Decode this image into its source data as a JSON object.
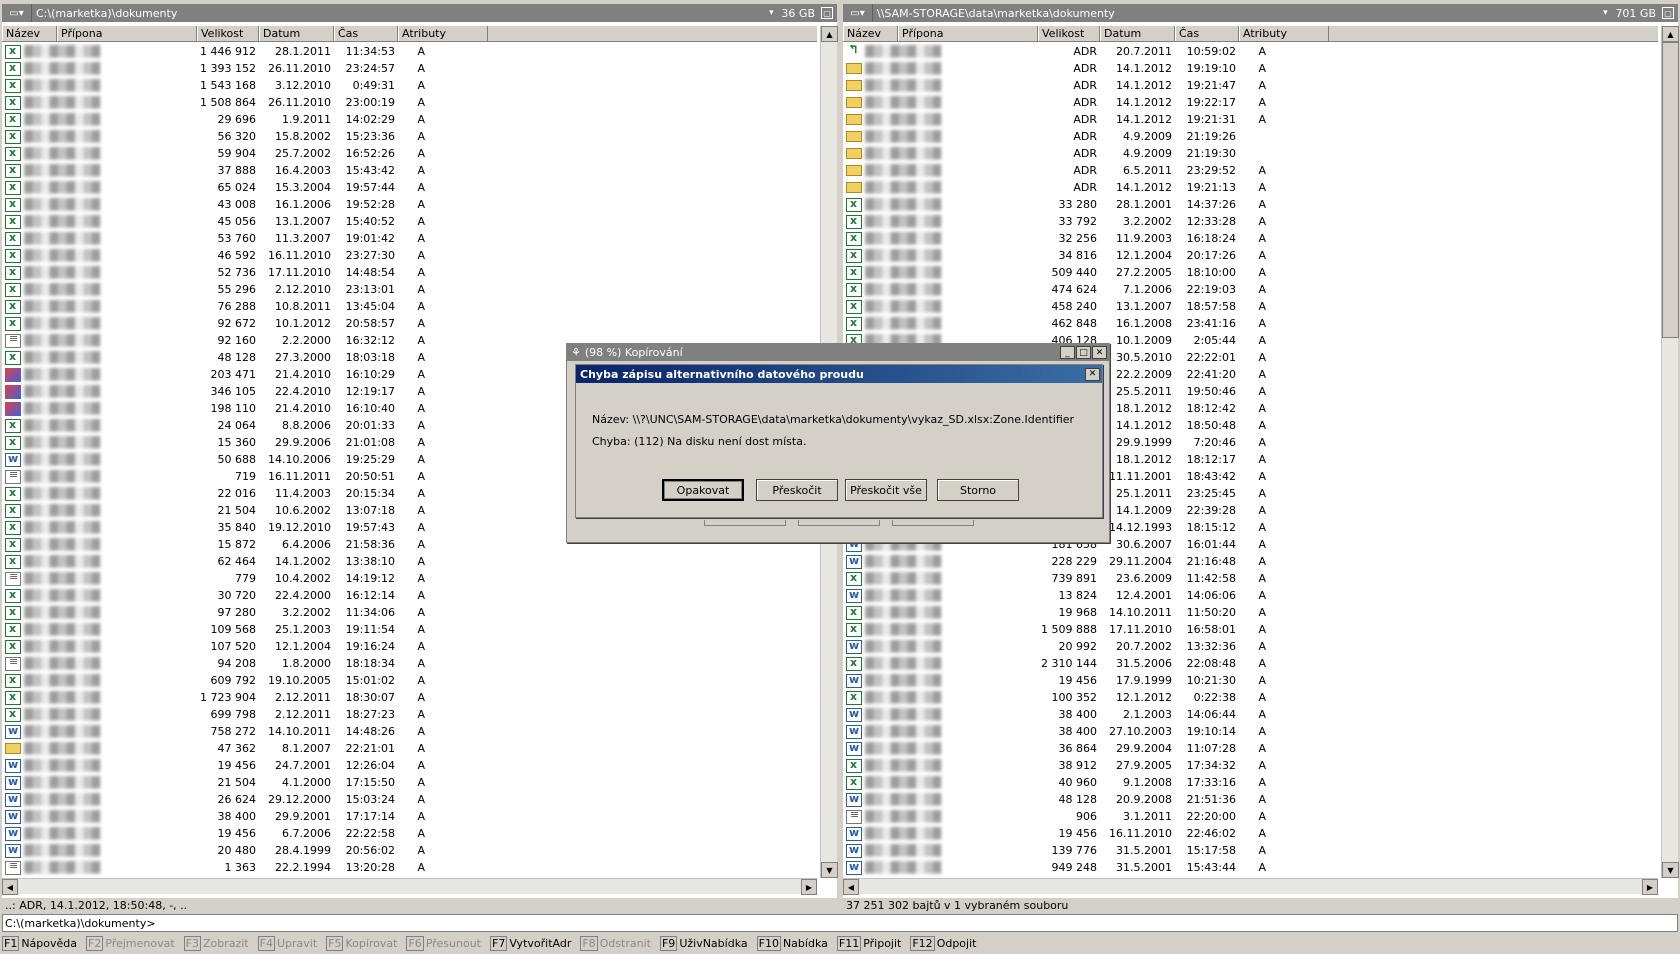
{
  "left": {
    "drive_label": "▾",
    "path": "C:\\(marketka)\\dokumenty",
    "free": "36 GB",
    "columns": [
      "Název",
      "Přípona",
      "Velikost",
      "Datum",
      "Čas",
      "Atributy"
    ],
    "status": "..: ADR, 14.1.2012, 18:50:48, -, ..",
    "rows": [
      {
        "icon": "xls",
        "size": "1 446 912",
        "date": "28.1.2011",
        "time": "11:34:53",
        "attr": "A"
      },
      {
        "icon": "xls",
        "size": "1 393 152",
        "date": "26.11.2010",
        "time": "23:24:57",
        "attr": "A"
      },
      {
        "icon": "xls",
        "size": "1 543 168",
        "date": "3.12.2010",
        "time": "0:49:31",
        "attr": "A"
      },
      {
        "icon": "xls",
        "size": "1 508 864",
        "date": "26.11.2010",
        "time": "23:00:19",
        "attr": "A"
      },
      {
        "icon": "xls",
        "size": "29 696",
        "date": "1.9.2011",
        "time": "14:02:29",
        "attr": "A"
      },
      {
        "icon": "xls",
        "size": "56 320",
        "date": "15.8.2002",
        "time": "15:23:36",
        "attr": "A"
      },
      {
        "icon": "xls",
        "size": "59 904",
        "date": "25.7.2002",
        "time": "16:52:26",
        "attr": "A"
      },
      {
        "icon": "xls",
        "size": "37 888",
        "date": "16.4.2003",
        "time": "15:43:42",
        "attr": "A"
      },
      {
        "icon": "xls",
        "size": "65 024",
        "date": "15.3.2004",
        "time": "19:57:44",
        "attr": "A"
      },
      {
        "icon": "xls",
        "size": "43 008",
        "date": "16.1.2006",
        "time": "19:52:28",
        "attr": "A"
      },
      {
        "icon": "xls",
        "size": "45 056",
        "date": "13.1.2007",
        "time": "15:40:52",
        "attr": "A"
      },
      {
        "icon": "xls",
        "size": "53 760",
        "date": "11.3.2007",
        "time": "19:01:42",
        "attr": "A"
      },
      {
        "icon": "xls",
        "size": "46 592",
        "date": "16.11.2010",
        "time": "23:27:30",
        "attr": "A"
      },
      {
        "icon": "xls",
        "size": "52 736",
        "date": "17.11.2010",
        "time": "14:48:54",
        "attr": "A"
      },
      {
        "icon": "xls",
        "size": "55 296",
        "date": "2.12.2010",
        "time": "23:13:01",
        "attr": "A"
      },
      {
        "icon": "xls",
        "size": "76 288",
        "date": "10.8.2011",
        "time": "13:45:04",
        "attr": "A"
      },
      {
        "icon": "xls",
        "size": "92 672",
        "date": "10.1.2012",
        "time": "20:58:57",
        "attr": "A"
      },
      {
        "icon": "txt",
        "size": "92 160",
        "date": "2.2.2000",
        "time": "16:32:12",
        "attr": "A"
      },
      {
        "icon": "xls",
        "size": "48 128",
        "date": "27.3.2000",
        "time": "18:03:18",
        "attr": "A"
      },
      {
        "icon": "img",
        "size": "203 471",
        "date": "21.4.2010",
        "time": "16:10:29",
        "attr": "A"
      },
      {
        "icon": "img",
        "size": "346 105",
        "date": "22.4.2010",
        "time": "12:19:17",
        "attr": "A"
      },
      {
        "icon": "img",
        "size": "198 110",
        "date": "21.4.2010",
        "time": "16:10:40",
        "attr": "A"
      },
      {
        "icon": "xls",
        "size": "24 064",
        "date": "8.8.2006",
        "time": "20:01:33",
        "attr": "A"
      },
      {
        "icon": "xls",
        "size": "15 360",
        "date": "29.9.2006",
        "time": "21:01:08",
        "attr": "A"
      },
      {
        "icon": "doc",
        "size": "50 688",
        "date": "14.10.2006",
        "time": "19:25:29",
        "attr": "A"
      },
      {
        "icon": "txt",
        "size": "719",
        "date": "16.11.2011",
        "time": "20:50:51",
        "attr": "A"
      },
      {
        "icon": "xls",
        "size": "22 016",
        "date": "11.4.2003",
        "time": "20:15:34",
        "attr": "A"
      },
      {
        "icon": "xls",
        "size": "21 504",
        "date": "10.6.2002",
        "time": "13:07:18",
        "attr": "A"
      },
      {
        "icon": "xls",
        "size": "35 840",
        "date": "19.12.2010",
        "time": "19:57:43",
        "attr": "A"
      },
      {
        "icon": "xls",
        "size": "15 872",
        "date": "6.4.2006",
        "time": "21:58:36",
        "attr": "A"
      },
      {
        "icon": "xls",
        "size": "62 464",
        "date": "14.1.2002",
        "time": "13:38:10",
        "attr": "A"
      },
      {
        "icon": "txt",
        "size": "779",
        "date": "10.4.2002",
        "time": "14:19:12",
        "attr": "A"
      },
      {
        "icon": "xls",
        "size": "30 720",
        "date": "22.4.2000",
        "time": "16:12:14",
        "attr": "A"
      },
      {
        "icon": "xls",
        "size": "97 280",
        "date": "3.2.2002",
        "time": "11:34:06",
        "attr": "A"
      },
      {
        "icon": "xls",
        "size": "109 568",
        "date": "25.1.2003",
        "time": "19:11:54",
        "attr": "A"
      },
      {
        "icon": "xls",
        "size": "107 520",
        "date": "12.1.2004",
        "time": "19:16:24",
        "attr": "A"
      },
      {
        "icon": "txt",
        "size": "94 208",
        "date": "1.8.2000",
        "time": "18:18:34",
        "attr": "A"
      },
      {
        "icon": "xls",
        "size": "609 792",
        "date": "19.10.2005",
        "time": "15:01:02",
        "attr": "A"
      },
      {
        "icon": "xls",
        "size": "1 723 904",
        "date": "2.12.2011",
        "time": "18:30:07",
        "attr": "A"
      },
      {
        "icon": "xls",
        "size": "699 798",
        "date": "2.12.2011",
        "time": "18:27:23",
        "attr": "A"
      },
      {
        "icon": "doc",
        "size": "758 272",
        "date": "14.10.2011",
        "time": "14:48:26",
        "attr": "A"
      },
      {
        "icon": "folder",
        "size": "47 362",
        "date": "8.1.2007",
        "time": "22:21:01",
        "attr": "A"
      },
      {
        "icon": "doc",
        "size": "19 456",
        "date": "24.7.2001",
        "time": "12:26:04",
        "attr": "A"
      },
      {
        "icon": "doc",
        "size": "21 504",
        "date": "4.1.2000",
        "time": "17:15:50",
        "attr": "A"
      },
      {
        "icon": "doc",
        "size": "26 624",
        "date": "29.12.2000",
        "time": "15:03:24",
        "attr": "A"
      },
      {
        "icon": "doc",
        "size": "38 400",
        "date": "29.9.2001",
        "time": "17:17:14",
        "attr": "A"
      },
      {
        "icon": "doc",
        "size": "19 456",
        "date": "6.7.2006",
        "time": "22:22:58",
        "attr": "A"
      },
      {
        "icon": "doc",
        "size": "20 480",
        "date": "28.4.1999",
        "time": "20:56:02",
        "attr": "A"
      },
      {
        "icon": "txt",
        "size": "1 363",
        "date": "22.2.1994",
        "time": "13:20:28",
        "attr": "A"
      }
    ]
  },
  "right": {
    "drive_label": "▾",
    "path": "\\\\SAM-STORAGE\\data\\marketka\\dokumenty",
    "free": "701 GB",
    "columns": [
      "Název",
      "Přípona",
      "Velikost",
      "Datum",
      "Čas",
      "Atributy"
    ],
    "status": "37 251 302 bajtů v 1 vybraném souboru",
    "rows": [
      {
        "icon": "up",
        "size": "ADR",
        "date": "20.7.2011",
        "time": "10:59:02",
        "attr": "A"
      },
      {
        "icon": "folder",
        "size": "ADR",
        "date": "14.1.2012",
        "time": "19:19:10",
        "attr": "A"
      },
      {
        "icon": "folder",
        "size": "ADR",
        "date": "14.1.2012",
        "time": "19:21:47",
        "attr": "A"
      },
      {
        "icon": "folder",
        "size": "ADR",
        "date": "14.1.2012",
        "time": "19:22:17",
        "attr": "A"
      },
      {
        "icon": "folder",
        "size": "ADR",
        "date": "14.1.2012",
        "time": "19:21:31",
        "attr": "A"
      },
      {
        "icon": "folder",
        "size": "ADR",
        "date": "4.9.2009",
        "time": "21:19:26",
        "attr": ""
      },
      {
        "icon": "folder",
        "size": "ADR",
        "date": "4.9.2009",
        "time": "21:19:30",
        "attr": ""
      },
      {
        "icon": "folder",
        "size": "ADR",
        "date": "6.5.2011",
        "time": "23:29:52",
        "attr": "A"
      },
      {
        "icon": "folder",
        "size": "ADR",
        "date": "14.1.2012",
        "time": "19:21:13",
        "attr": "A"
      },
      {
        "icon": "xls",
        "size": "33 280",
        "date": "28.1.2001",
        "time": "14:37:26",
        "attr": "A"
      },
      {
        "icon": "xls",
        "size": "33 792",
        "date": "3.2.2002",
        "time": "12:33:28",
        "attr": "A"
      },
      {
        "icon": "xls",
        "size": "32 256",
        "date": "11.9.2003",
        "time": "16:18:24",
        "attr": "A"
      },
      {
        "icon": "xls",
        "size": "34 816",
        "date": "12.1.2004",
        "time": "20:17:26",
        "attr": "A"
      },
      {
        "icon": "xls",
        "size": "509 440",
        "date": "27.2.2005",
        "time": "18:10:00",
        "attr": "A"
      },
      {
        "icon": "xls",
        "size": "474 624",
        "date": "7.1.2006",
        "time": "22:19:03",
        "attr": "A"
      },
      {
        "icon": "xls",
        "size": "458 240",
        "date": "13.1.2007",
        "time": "18:57:58",
        "attr": "A"
      },
      {
        "icon": "xls",
        "size": "462 848",
        "date": "16.1.2008",
        "time": "23:41:16",
        "attr": "A"
      },
      {
        "icon": "xls",
        "size": "406 128",
        "date": "10.1.2009",
        "time": "2:05:44",
        "attr": "A"
      },
      {
        "icon": "xls",
        "size": "",
        "date": "30.5.2010",
        "time": "22:22:01",
        "attr": "A"
      },
      {
        "icon": "xls",
        "size": "",
        "date": "22.2.2009",
        "time": "22:41:20",
        "attr": "A"
      },
      {
        "icon": "xls",
        "size": "",
        "date": "25.5.2011",
        "time": "19:50:46",
        "attr": "A"
      },
      {
        "icon": "xls",
        "size": "",
        "date": "18.1.2012",
        "time": "18:12:42",
        "attr": "A"
      },
      {
        "icon": "xls",
        "size": "",
        "date": "14.1.2012",
        "time": "18:50:48",
        "attr": "A"
      },
      {
        "icon": "xls",
        "size": "",
        "date": "29.9.1999",
        "time": "7:20:46",
        "attr": "A"
      },
      {
        "icon": "xls",
        "size": "",
        "date": "18.1.2012",
        "time": "18:12:17",
        "attr": "A"
      },
      {
        "icon": "xls",
        "size": "",
        "date": "11.11.2001",
        "time": "18:43:42",
        "attr": "A"
      },
      {
        "icon": "xls",
        "size": "",
        "date": "25.1.2011",
        "time": "23:25:45",
        "attr": "A"
      },
      {
        "icon": "xls",
        "size": "",
        "date": "14.1.2009",
        "time": "22:39:28",
        "attr": "A"
      },
      {
        "icon": "xls",
        "size": "",
        "date": "14.12.1993",
        "time": "18:15:12",
        "attr": "A"
      },
      {
        "icon": "doc",
        "size": "181 658",
        "date": "30.6.2007",
        "time": "16:01:44",
        "attr": "A"
      },
      {
        "icon": "doc",
        "size": "228 229",
        "date": "29.11.2004",
        "time": "21:16:48",
        "attr": "A"
      },
      {
        "icon": "xls",
        "size": "739 891",
        "date": "23.6.2009",
        "time": "11:42:58",
        "attr": "A"
      },
      {
        "icon": "doc",
        "size": "13 824",
        "date": "12.4.2001",
        "time": "14:06:06",
        "attr": "A"
      },
      {
        "icon": "xls",
        "size": "19 968",
        "date": "14.10.2011",
        "time": "11:50:20",
        "attr": "A"
      },
      {
        "icon": "xls",
        "size": "1 509 888",
        "date": "17.11.2010",
        "time": "16:58:01",
        "attr": "A"
      },
      {
        "icon": "doc",
        "size": "20 992",
        "date": "20.7.2002",
        "time": "13:32:36",
        "attr": "A"
      },
      {
        "icon": "xls",
        "size": "2 310 144",
        "date": "31.5.2006",
        "time": "22:08:48",
        "attr": "A"
      },
      {
        "icon": "doc",
        "size": "19 456",
        "date": "17.9.1999",
        "time": "10:21:30",
        "attr": "A"
      },
      {
        "icon": "xls",
        "size": "100 352",
        "date": "12.1.2012",
        "time": "0:22:38",
        "attr": "A"
      },
      {
        "icon": "doc",
        "size": "38 400",
        "date": "2.1.2003",
        "time": "14:06:44",
        "attr": "A"
      },
      {
        "icon": "doc",
        "size": "38 400",
        "date": "27.10.2003",
        "time": "19:10:14",
        "attr": "A"
      },
      {
        "icon": "doc",
        "size": "36 864",
        "date": "29.9.2004",
        "time": "11:07:28",
        "attr": "A"
      },
      {
        "icon": "xls",
        "size": "38 912",
        "date": "27.9.2005",
        "time": "17:34:32",
        "attr": "A"
      },
      {
        "icon": "xls",
        "size": "40 960",
        "date": "9.1.2008",
        "time": "17:33:16",
        "attr": "A"
      },
      {
        "icon": "doc",
        "size": "48 128",
        "date": "20.9.2008",
        "time": "21:51:36",
        "attr": "A"
      },
      {
        "icon": "txt",
        "size": "906",
        "date": "3.1.2011",
        "time": "22:20:00",
        "attr": "A"
      },
      {
        "icon": "doc",
        "size": "19 456",
        "date": "16.11.2010",
        "time": "22:46:02",
        "attr": "A"
      },
      {
        "icon": "doc",
        "size": "139 776",
        "date": "31.5.2001",
        "time": "15:17:58",
        "attr": "A"
      },
      {
        "icon": "doc",
        "size": "949 248",
        "date": "31.5.2001",
        "time": "15:43:44",
        "attr": "A"
      }
    ]
  },
  "command_line": "C:\\(marketka)\\dokumenty>",
  "fkeys": [
    {
      "key": "F1",
      "label": "Nápověda",
      "enabled": true
    },
    {
      "key": "F2",
      "label": "Přejmenovat",
      "enabled": false
    },
    {
      "key": "F3",
      "label": "Zobrazit",
      "enabled": false
    },
    {
      "key": "F4",
      "label": "Upravit",
      "enabled": false
    },
    {
      "key": "F5",
      "label": "Kopírovat",
      "enabled": false
    },
    {
      "key": "F6",
      "label": "Přesunout",
      "enabled": false
    },
    {
      "key": "F7",
      "label": "VytvořitAdr",
      "enabled": true
    },
    {
      "key": "F8",
      "label": "Odstranit",
      "enabled": false
    },
    {
      "key": "F9",
      "label": "UživNabídka",
      "enabled": true
    },
    {
      "key": "F10",
      "label": "Nabídka",
      "enabled": true
    },
    {
      "key": "F11",
      "label": "Připojit",
      "enabled": true
    },
    {
      "key": "F12",
      "label": "Odpojit",
      "enabled": true
    }
  ],
  "copy_dialog": {
    "title": "(98 %) Kopírování"
  },
  "error_dialog": {
    "title": "Chyba zápisu alternativního datového proudu",
    "name_line": "Název: \\\\?\\UNC\\SAM-STORAGE\\data\\marketka\\dokumenty\\vykaz_SD.xlsx:Zone.Identifier",
    "error_line": "Chyba: (112) Na disku není dost místa.",
    "buttons": {
      "retry": "Opakovat",
      "skip": "Přeskočit",
      "skip_all": "Přeskočit vše",
      "cancel": "Storno"
    }
  }
}
